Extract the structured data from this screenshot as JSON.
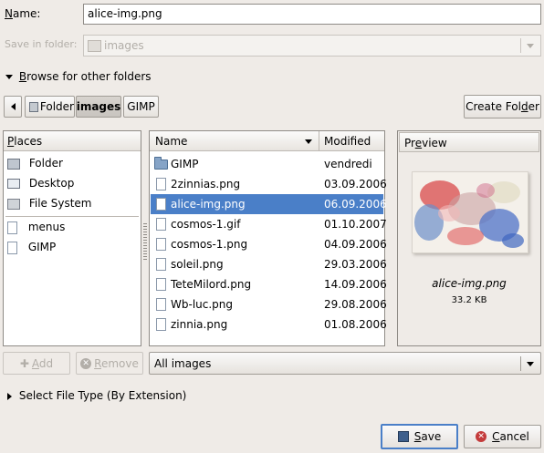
{
  "name_label": "Name:",
  "name_value": "alice-img.png",
  "save_in_label": "Save in folder:",
  "save_in_value": "images",
  "browse_label": "Browse for other folders",
  "path": {
    "folder_label": "Folder",
    "images_label": "images",
    "gimp_label": "GIMP"
  },
  "create_folder_label": "Create Folder",
  "places": {
    "header": "Places",
    "items": [
      {
        "label": "Folder",
        "icon": "home-icon"
      },
      {
        "label": "Desktop",
        "icon": "desktop-icon"
      },
      {
        "label": "File System",
        "icon": "drive-icon"
      }
    ],
    "bookmarks": [
      {
        "label": "menus",
        "icon": "folder-icon"
      },
      {
        "label": "GIMP",
        "icon": "folder-icon"
      }
    ]
  },
  "files": {
    "col_name": "Name",
    "col_modified": "Modified",
    "rows": [
      {
        "name": "GIMP",
        "modified": "vendredi",
        "icon": "folder-icon"
      },
      {
        "name": "2zinnias.png",
        "modified": "03.09.2006",
        "icon": "image-file-icon"
      },
      {
        "name": "alice-img.png",
        "modified": "06.09.2006",
        "icon": "image-file-icon",
        "selected": true
      },
      {
        "name": "cosmos-1.gif",
        "modified": "01.10.2007",
        "icon": "image-file-icon"
      },
      {
        "name": "cosmos-1.png",
        "modified": "04.09.2006",
        "icon": "image-file-icon"
      },
      {
        "name": "soleil.png",
        "modified": "29.03.2006",
        "icon": "image-file-icon"
      },
      {
        "name": "TeteMilord.png",
        "modified": "14.09.2006",
        "icon": "image-file-icon"
      },
      {
        "name": "Wb-luc.png",
        "modified": "29.08.2006",
        "icon": "image-file-icon"
      },
      {
        "name": "zinnia.png",
        "modified": "01.08.2006",
        "icon": "image-file-icon"
      }
    ]
  },
  "preview": {
    "header": "Preview",
    "filename": "alice-img.png",
    "size": "33.2 KB"
  },
  "add_label": "Add",
  "remove_label": "Remove",
  "filter_value": "All images",
  "select_type_label": "Select File Type (By Extension)",
  "save_label": "Save",
  "cancel_label": "Cancel",
  "colors": {
    "selection": "#4a7fc8",
    "background": "#efebe7"
  }
}
